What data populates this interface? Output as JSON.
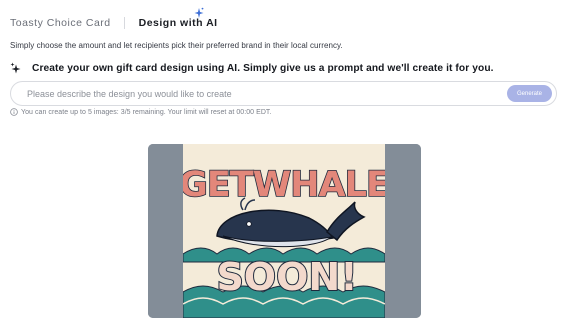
{
  "tabs": [
    {
      "label": "Toasty Choice Card",
      "active": false
    },
    {
      "label": "Design with AI",
      "active": true
    }
  ],
  "description": "Simply choose the amount and let recipients pick their preferred brand in their local currency.",
  "headline": "Create your own gift card design using AI. Simply give us a prompt and we'll create it for you.",
  "prompt": {
    "placeholder": "Please describe the design you would like to create",
    "value": "",
    "generate_label": "Generate"
  },
  "limit_note": "You can create up to 5 images: 3/5 remaining. Your limit will reset at 00:00 EDT.",
  "preview": {
    "title_line1": "GETWHALE",
    "title_line2": "SOON!"
  },
  "icons": {
    "tab_ai": "sparkle-icon",
    "headline": "sparkle-icon",
    "limit": "info-icon"
  },
  "colors": {
    "accent": "#a9b3e6",
    "sparkle": "#3d6fd6",
    "card_bg": "#f4ebd9",
    "side_panel": "#838d98",
    "letter_fill": "#e3877a",
    "letter_outline": "#1f2a3d",
    "wave_teal": "#2f8f8a"
  }
}
